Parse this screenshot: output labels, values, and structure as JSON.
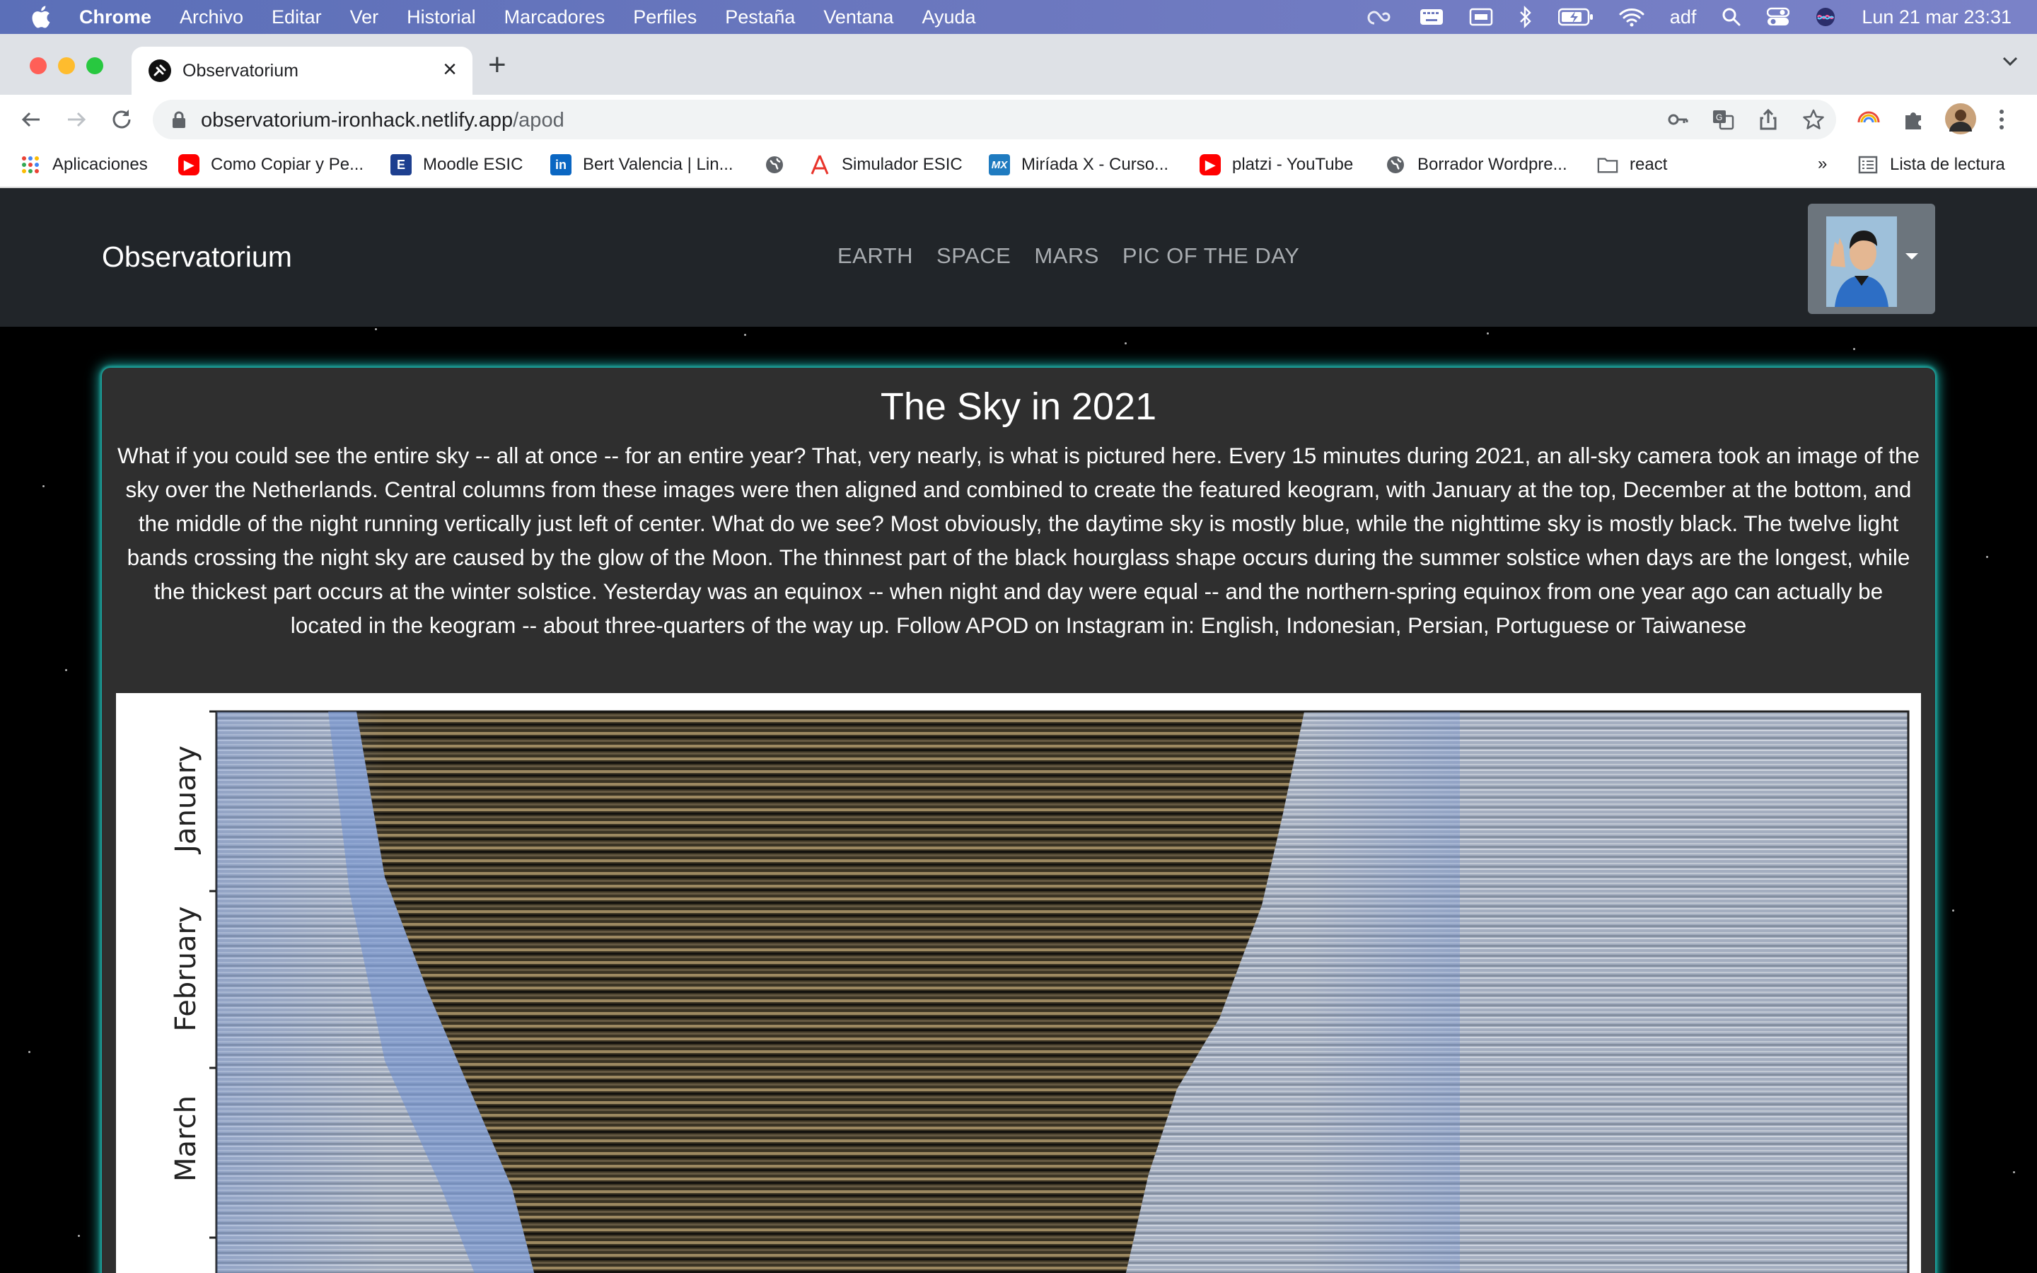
{
  "menubar": {
    "app": "Chrome",
    "items": [
      "Archivo",
      "Editar",
      "Ver",
      "Historial",
      "Marcadores",
      "Perfiles",
      "Pestaña",
      "Ventana",
      "Ayuda"
    ],
    "user": "adf",
    "datetime": "Lun 21 mar  23:31",
    "icons": [
      "creative-cloud-icon",
      "keyboard-icon",
      "display-icon",
      "bluetooth-icon",
      "battery-icon",
      "wifi-icon",
      "search-icon",
      "control-center-icon",
      "siri-icon"
    ]
  },
  "tab": {
    "title": "Observatorium",
    "close": "×"
  },
  "toolbar": {
    "url_host": "observatorium-ironhack.netlify.app",
    "url_path": "/apod"
  },
  "bookmarks": {
    "items": [
      {
        "label": "Aplicaciones",
        "icon": "apps-grid-icon"
      },
      {
        "label": "Como Copiar y Pe...",
        "icon": "youtube-icon"
      },
      {
        "label": "Moodle ESIC",
        "icon": "esic-icon"
      },
      {
        "label": "Bert Valencia | Lin...",
        "icon": "linkedin-icon"
      },
      {
        "label": "",
        "icon": "globe-icon"
      },
      {
        "label": "Simulador ESIC",
        "icon": "acrobat-icon"
      },
      {
        "label": "Miríada X - Curso...",
        "icon": "miriadax-icon"
      },
      {
        "label": "platzi - YouTube",
        "icon": "youtube-icon"
      },
      {
        "label": "Borrador Wordpre...",
        "icon": "globe-icon"
      },
      {
        "label": "react",
        "icon": "folder-icon"
      }
    ],
    "overflow": "»",
    "reading_list": "Lista de lectura"
  },
  "navbar": {
    "brand": "Observatorium",
    "links": [
      "EARTH",
      "SPACE",
      "MARS",
      "PIC OF THE DAY"
    ]
  },
  "apod": {
    "title": "The Sky in 2021",
    "explanation": "What if you could see the entire sky -- all at once -- for an entire year? That, very nearly, is what is pictured here. Every 15 minutes during 2021, an all-sky camera took an image of the sky over the Netherlands. Central columns from these images were then aligned and combined to create the featured keogram, with January at the top, December at the bottom, and the middle of the night running vertically just left of center. What do we see? Most obviously, the daytime sky is mostly blue, while the nighttime sky is mostly black. The twelve light bands crossing the night sky are caused by the glow of the Moon. The thinnest part of the black hourglass shape occurs during the summer solstice when days are the longest, while the thickest part occurs at the winter solstice. Yesterday was an equinox -- when night and day were equal -- and the northern-spring equinox from one year ago can actually be located in the keogram -- about three-quarters of the way up. Follow APOD on Instagram in: English, Indonesian, Persian, Portuguese or Taiwanese",
    "image_labels": [
      "January",
      "February",
      "March"
    ]
  }
}
